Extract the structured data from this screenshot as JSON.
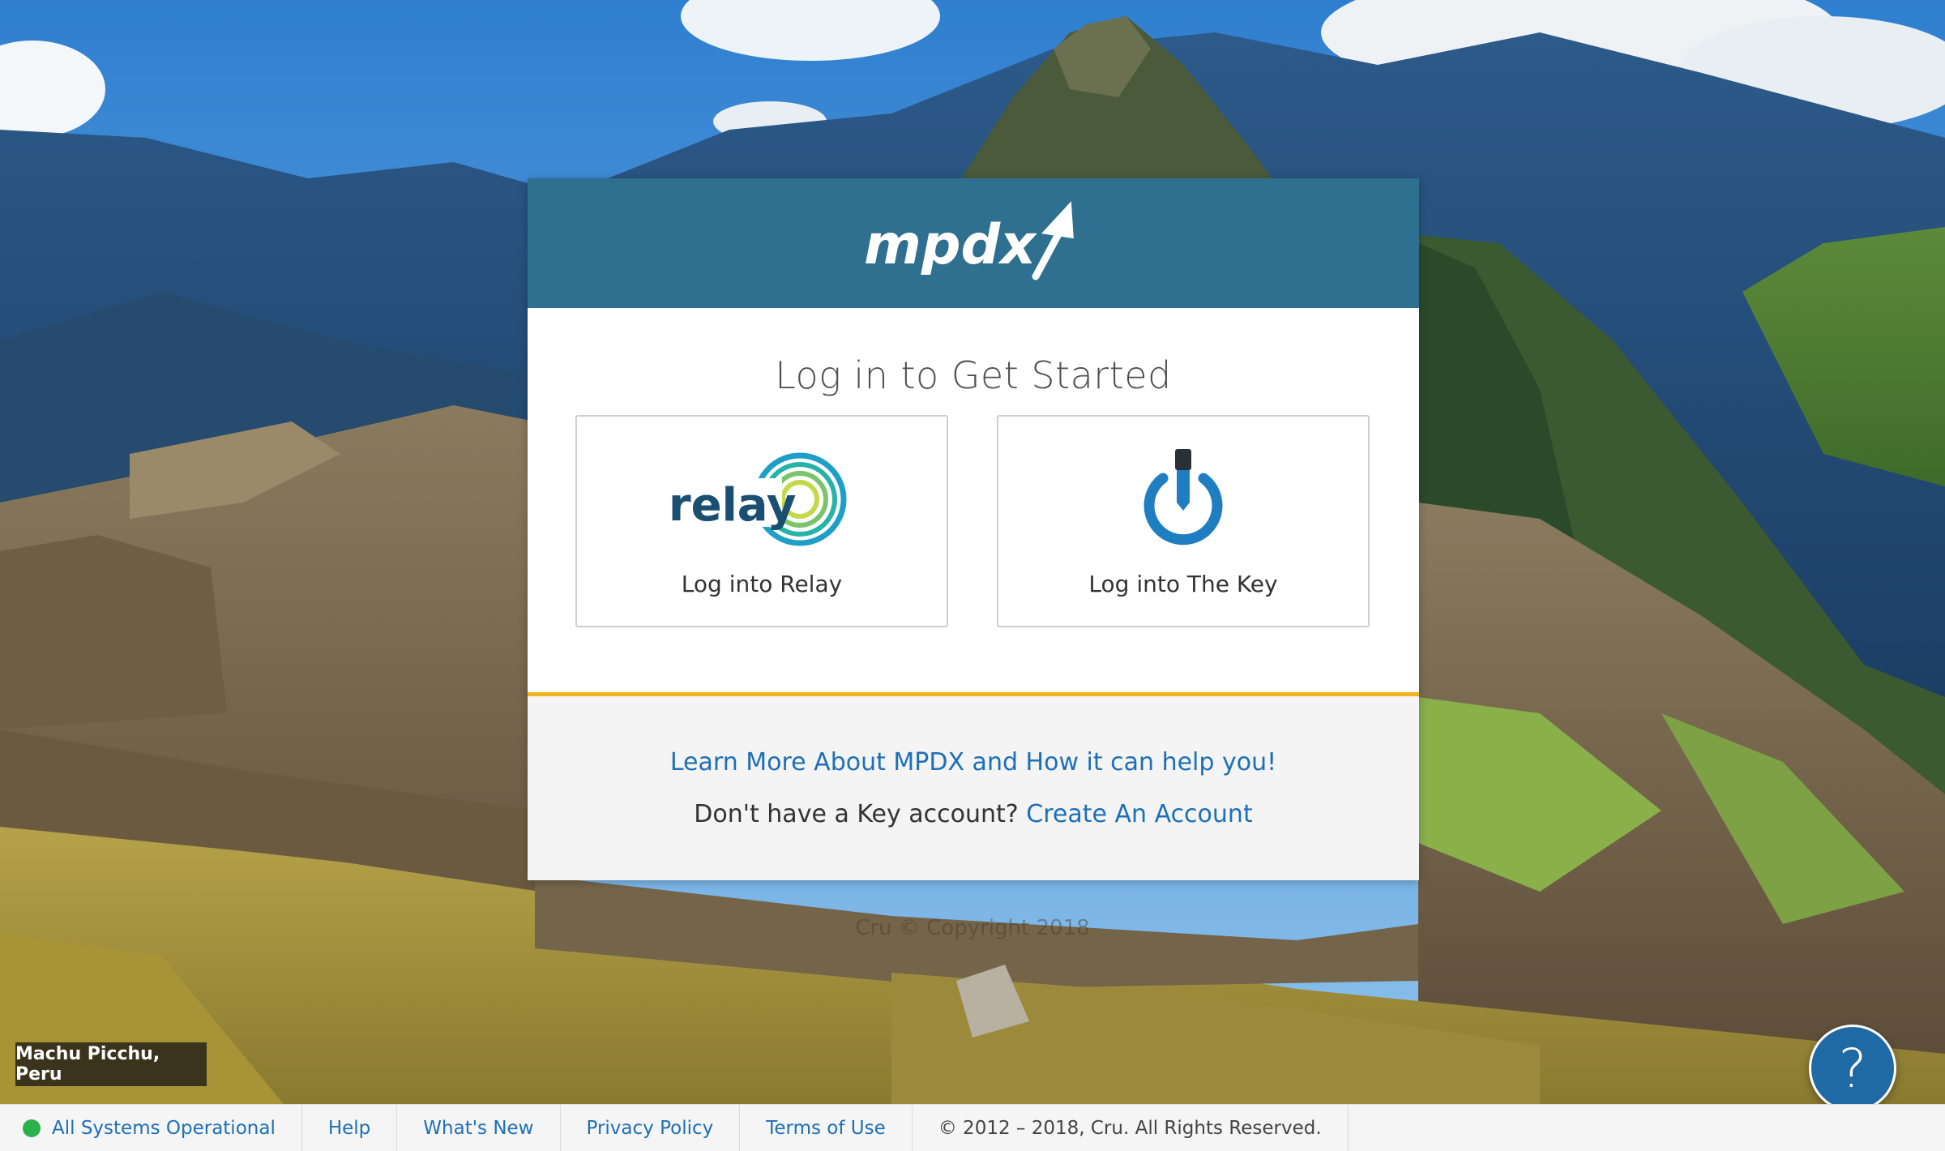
{
  "background": {
    "location_caption": "Machu Picchu, Peru",
    "faint_text": "Cru © Copyright 2018"
  },
  "card": {
    "header_logo_text": "mpdx",
    "title": "Log in to Get Started",
    "relay": {
      "logo_text": "relay",
      "label": "Log into Relay"
    },
    "key": {
      "label": "Log into The Key"
    },
    "learn_more": "Learn More About MPDX and How it can help you!",
    "no_account_text": "Don't have a Key account?",
    "create_account": "Create An Account",
    "colors": {
      "header": "#2f6f8f",
      "accent": "#f0b41c",
      "link": "#1d6fb8"
    }
  },
  "help_button": {
    "icon": "question-icon",
    "label": "?"
  },
  "footer": {
    "status": "All Systems Operational",
    "status_color": "#2bb24c",
    "links": [
      "Help",
      "What's New",
      "Privacy Policy",
      "Terms of Use"
    ],
    "copyright": "© 2012 – 2018, Cru. All Rights Reserved."
  }
}
